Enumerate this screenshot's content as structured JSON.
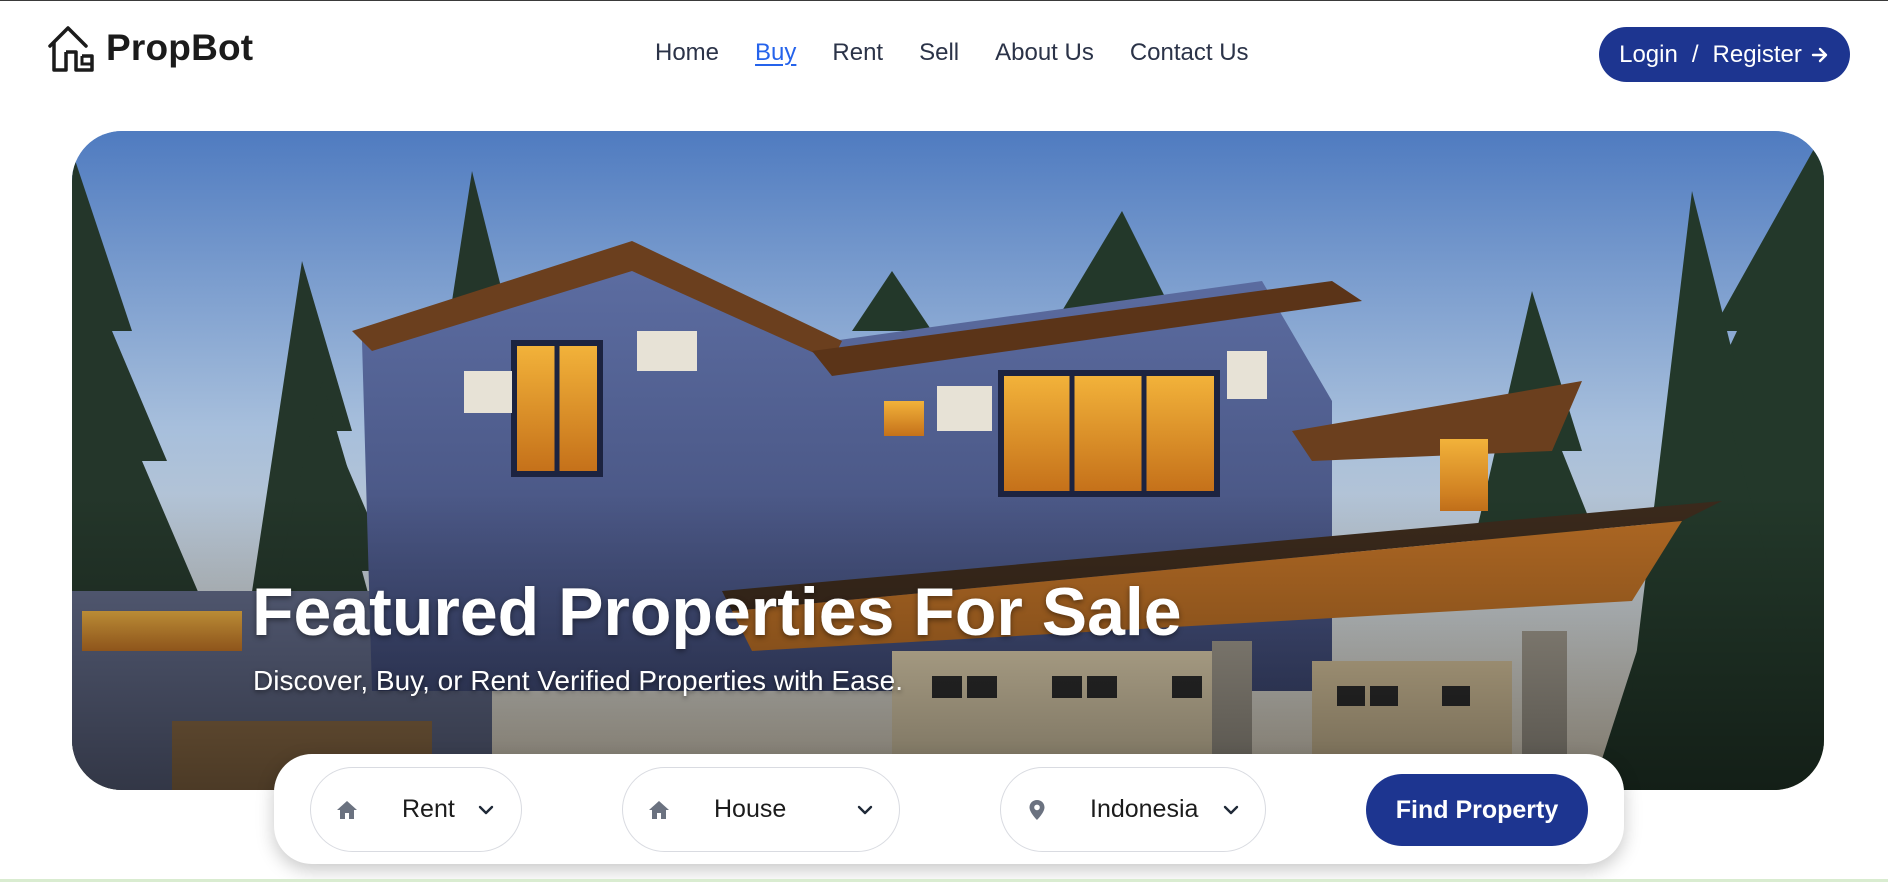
{
  "brand": {
    "name": "PropBot",
    "logo_icon": "house-outline-icon"
  },
  "nav": {
    "items": [
      {
        "label": "Home",
        "active": false
      },
      {
        "label": "Buy",
        "active": true
      },
      {
        "label": "Rent",
        "active": false
      },
      {
        "label": "Sell",
        "active": false
      },
      {
        "label": "About Us",
        "active": false
      },
      {
        "label": "Contact Us",
        "active": false
      }
    ]
  },
  "auth": {
    "login_label": "Login",
    "separator": "/",
    "register_label": "Register",
    "icon": "arrow-right-icon"
  },
  "hero": {
    "title": "Featured Properties For Sale",
    "subtitle": "Discover, Buy, or Rent Verified Properties with Ease."
  },
  "search": {
    "listing_type": {
      "value": "Rent",
      "icon": "home-icon"
    },
    "property_type": {
      "value": "House",
      "icon": "home-icon"
    },
    "location": {
      "value": "Indonesia",
      "icon": "map-pin-icon"
    },
    "submit_label": "Find Property"
  },
  "colors": {
    "primary": "#1d3590",
    "active_link": "#2563eb",
    "nav_text": "#2b3348"
  }
}
